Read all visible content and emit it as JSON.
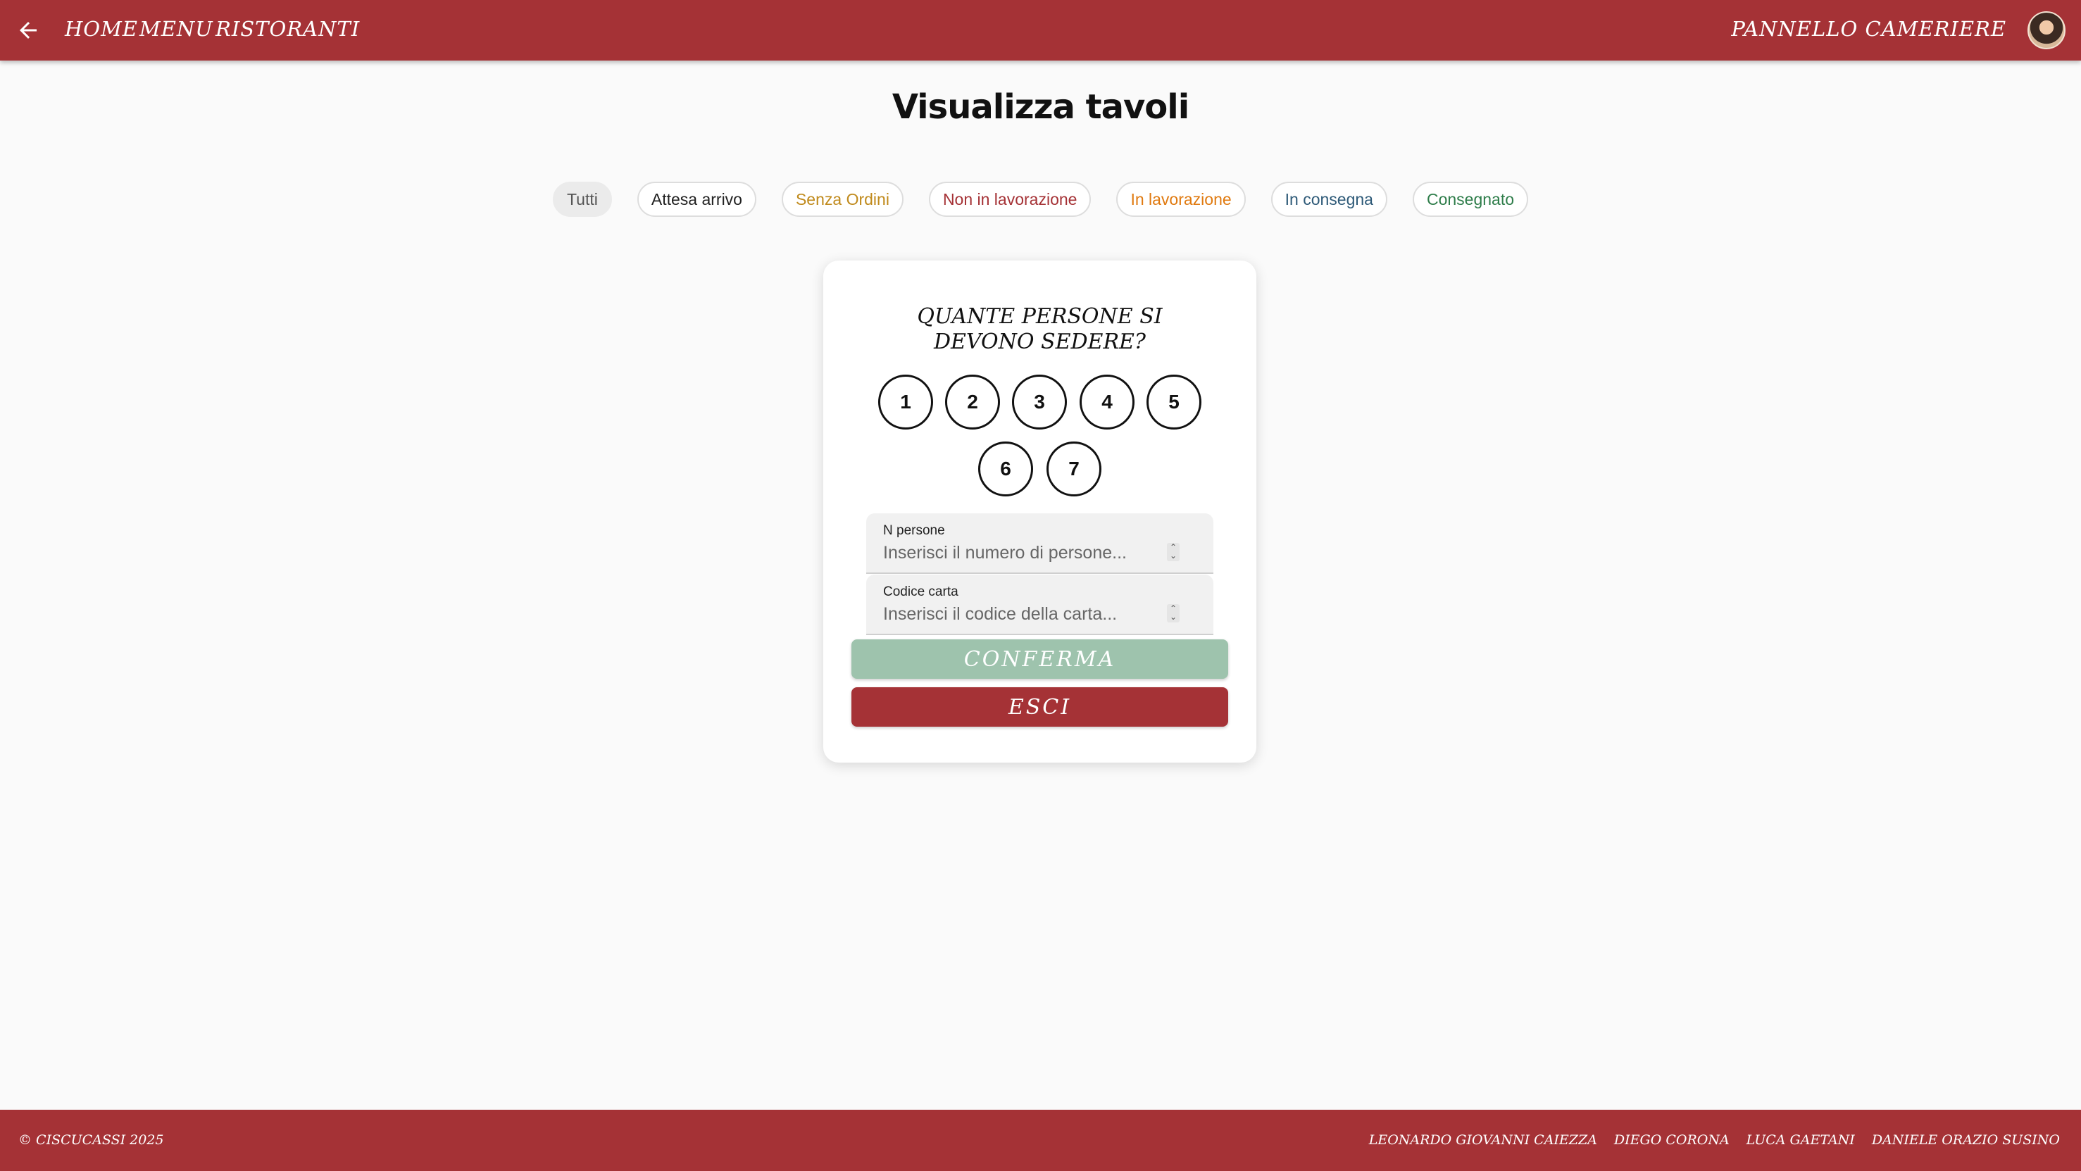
{
  "header": {
    "nav": [
      "HOME",
      "MENU",
      "RISTORANTI"
    ],
    "panel_title": "PANNELLO CAMERIERE"
  },
  "page": {
    "title": "Visualizza tavoli"
  },
  "filters": [
    {
      "label": "Tutti",
      "color": "#555555"
    },
    {
      "label": "Attesa arrivo",
      "color": "#222222"
    },
    {
      "label": "Senza Ordini",
      "color": "#c08a1c"
    },
    {
      "label": "Non in lavorazione",
      "color": "#a53236"
    },
    {
      "label": "In lavorazione",
      "color": "#e07a10"
    },
    {
      "label": "In consegna",
      "color": "#2e5a78"
    },
    {
      "label": "Consegnato",
      "color": "#2e7d4a"
    }
  ],
  "dialog": {
    "question": "QUANTE PERSONE SI DEVONO SEDERE?",
    "numbers": [
      "1",
      "2",
      "3",
      "4",
      "5",
      "6",
      "7"
    ],
    "people_field": {
      "label": "N persone",
      "placeholder": "Inserisci il numero di persone..."
    },
    "card_field": {
      "label": "Codice carta",
      "placeholder": "Inserisci il codice della carta..."
    },
    "confirm_label": "CONFERMA",
    "exit_label": "ESCI"
  },
  "footer": {
    "copyright": "© CISCUCASSI 2025",
    "authors": [
      "LEONARDO GIOVANNI CAIEZZA",
      "DIEGO CORONA",
      "LUCA GAETANI",
      "DANIELE ORAZIO SUSINO"
    ]
  },
  "colors": {
    "brand": "#a53236",
    "confirm": "#9ec3ad"
  }
}
